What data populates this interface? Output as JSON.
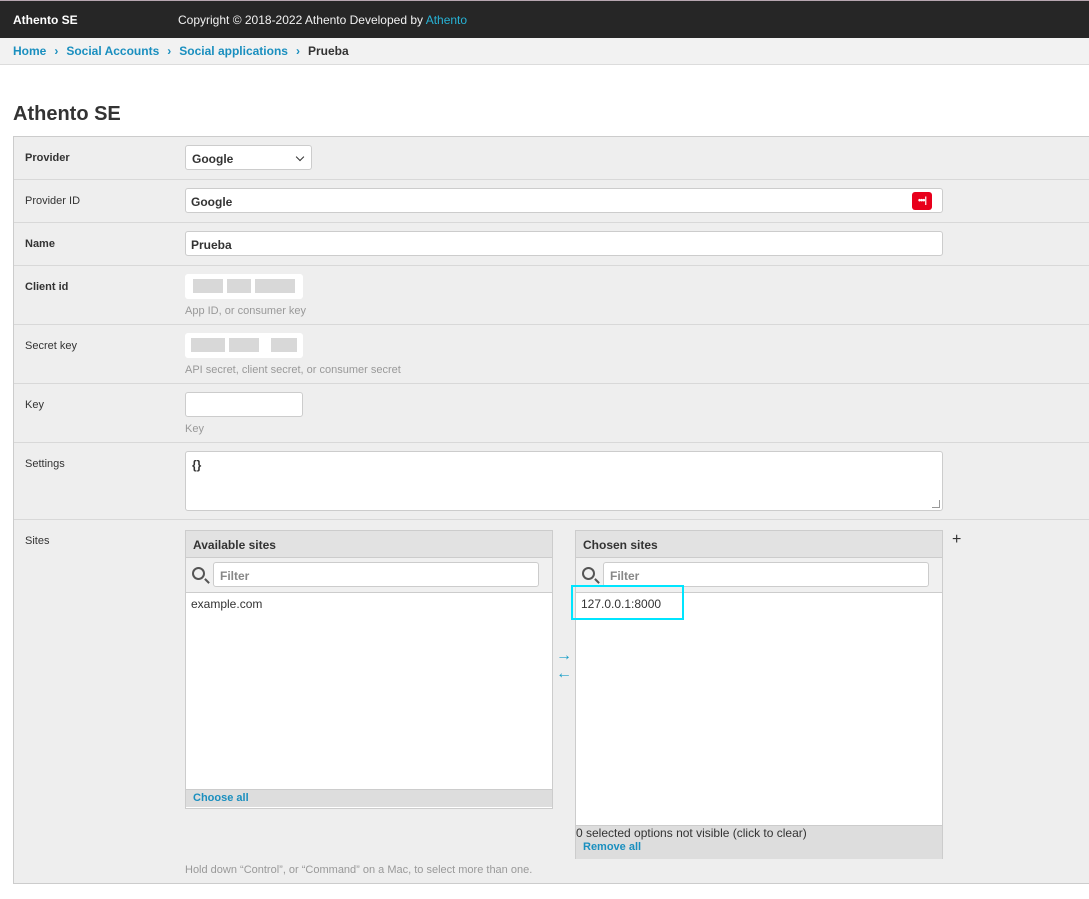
{
  "topbar": {
    "brand": "Athento SE",
    "copyright_prefix": "Copyright © 2018-2022 Athento Developed by ",
    "copyright_link": "Athento"
  },
  "breadcrumbs": {
    "home": "Home",
    "social_accounts": "Social Accounts",
    "social_applications": "Social applications",
    "current": "Prueba",
    "separator": "›"
  },
  "page": {
    "title": "Athento SE"
  },
  "form": {
    "provider": {
      "label": "Provider",
      "value": "Google"
    },
    "provider_id": {
      "label": "Provider ID",
      "value": "Google",
      "pw_icon": "•••|"
    },
    "name": {
      "label": "Name",
      "value": "Prueba"
    },
    "client_id": {
      "label": "Client id",
      "help": "App ID, or consumer key"
    },
    "secret_key": {
      "label": "Secret key",
      "help": "API secret, client secret, or consumer secret"
    },
    "key": {
      "label": "Key",
      "value": "",
      "help": "Key"
    },
    "settings": {
      "label": "Settings",
      "value": "{}"
    },
    "sites": {
      "label": "Sites",
      "available": {
        "title": "Available sites",
        "filter_placeholder": "Filter",
        "options": [
          "example.com"
        ],
        "choose_all": "Choose all"
      },
      "chosen": {
        "title": "Chosen sites",
        "filter_placeholder": "Filter",
        "options": [
          "127.0.0.1:8000"
        ],
        "hidden_note": "0 selected options not visible (click to clear)",
        "remove_all": "Remove all"
      },
      "add_label": "+",
      "move_right": "→",
      "move_left": "←",
      "help": "Hold down “Control”, or “Command” on a Mac, to select more than one."
    }
  },
  "colors": {
    "topbar_bg": "#262626",
    "link": "#1a8fbf",
    "highlight": "#00e5ff",
    "password_manager_icon": "#e8001c"
  }
}
